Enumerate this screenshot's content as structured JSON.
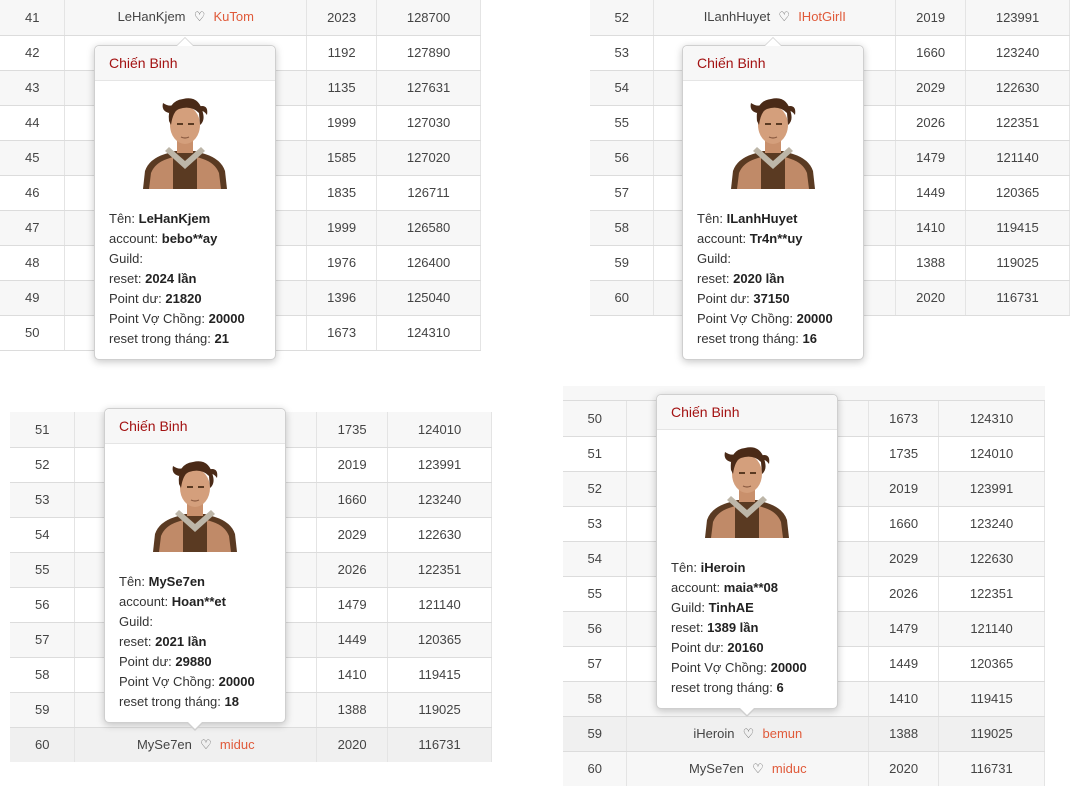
{
  "heart_glyph": "♡",
  "panels": [
    {
      "rows": [
        {
          "rank": "41",
          "name": "LeHanKjem",
          "partner": "KuTom",
          "reset": "2023",
          "point": "128700"
        },
        {
          "rank": "42",
          "name": "",
          "partner": "",
          "reset": "1192",
          "point": "127890"
        },
        {
          "rank": "43",
          "name": "",
          "partner": "",
          "reset": "1135",
          "point": "127631"
        },
        {
          "rank": "44",
          "name": "",
          "partner": "",
          "reset": "1999",
          "point": "127030"
        },
        {
          "rank": "45",
          "name": "",
          "partner": "",
          "reset": "1585",
          "point": "127020"
        },
        {
          "rank": "46",
          "name": "",
          "partner": "",
          "reset": "1835",
          "point": "126711"
        },
        {
          "rank": "47",
          "name": "",
          "partner": "",
          "reset": "1999",
          "point": "126580"
        },
        {
          "rank": "48",
          "name": "",
          "partner": "",
          "reset": "1976",
          "point": "126400"
        },
        {
          "rank": "49",
          "name": "",
          "partner": "",
          "reset": "1396",
          "point": "125040"
        },
        {
          "rank": "50",
          "name": "",
          "partner": "",
          "reset": "1673",
          "point": "124310"
        }
      ],
      "popup": {
        "title": "Chiến Binh",
        "lines": [
          {
            "label": "Tên: ",
            "value": "LeHanKjem"
          },
          {
            "label": "account: ",
            "value": "bebo**ay"
          },
          {
            "label": "Guild: ",
            "value": ""
          },
          {
            "label": "reset: ",
            "value": "2024 lần"
          },
          {
            "label": "Point dư: ",
            "value": "21820"
          },
          {
            "label": "Point Vợ Chồng: ",
            "value": "20000"
          },
          {
            "label": "reset trong tháng: ",
            "value": "21"
          }
        ]
      }
    },
    {
      "rows": [
        {
          "rank": "52",
          "name": "ILanhHuyet",
          "partner": "IHotGirlI",
          "reset": "2019",
          "point": "123991"
        },
        {
          "rank": "53",
          "name": "",
          "partner": "",
          "reset": "1660",
          "point": "123240"
        },
        {
          "rank": "54",
          "name": "",
          "partner": "",
          "reset": "2029",
          "point": "122630"
        },
        {
          "rank": "55",
          "name": "",
          "partner": "",
          "reset": "2026",
          "point": "122351"
        },
        {
          "rank": "56",
          "name": "",
          "partner": "",
          "reset": "1479",
          "point": "121140"
        },
        {
          "rank": "57",
          "name": "",
          "partner": "",
          "reset": "1449",
          "point": "120365"
        },
        {
          "rank": "58",
          "name": "",
          "partner": "",
          "reset": "1410",
          "point": "119415"
        },
        {
          "rank": "59",
          "name": "",
          "partner": "",
          "reset": "1388",
          "point": "119025"
        },
        {
          "rank": "60",
          "name": "",
          "partner": "",
          "reset": "2020",
          "point": "116731"
        }
      ],
      "popup": {
        "title": "Chiến Binh",
        "lines": [
          {
            "label": "Tên: ",
            "value": "ILanhHuyet"
          },
          {
            "label": "account: ",
            "value": "Tr4n**uy"
          },
          {
            "label": "Guild: ",
            "value": ""
          },
          {
            "label": "reset: ",
            "value": "2020 lần"
          },
          {
            "label": "Point dư: ",
            "value": "37150"
          },
          {
            "label": "Point Vợ Chồng: ",
            "value": "20000"
          },
          {
            "label": "reset trong tháng: ",
            "value": "16"
          }
        ]
      }
    },
    {
      "rows": [
        {
          "rank": "51",
          "name": "",
          "partner": "",
          "reset": "1735",
          "point": "124010"
        },
        {
          "rank": "52",
          "name": "",
          "partner": "",
          "reset": "2019",
          "point": "123991"
        },
        {
          "rank": "53",
          "name": "",
          "partner": "",
          "reset": "1660",
          "point": "123240"
        },
        {
          "rank": "54",
          "name": "",
          "partner": "",
          "reset": "2029",
          "point": "122630"
        },
        {
          "rank": "55",
          "name": "",
          "partner": "",
          "reset": "2026",
          "point": "122351"
        },
        {
          "rank": "56",
          "name": "",
          "partner": "",
          "reset": "1479",
          "point": "121140"
        },
        {
          "rank": "57",
          "name": "",
          "partner": "",
          "reset": "1449",
          "point": "120365"
        },
        {
          "rank": "58",
          "name": "",
          "partner": "",
          "reset": "1410",
          "point": "119415"
        },
        {
          "rank": "59",
          "name": "",
          "partner": "",
          "reset": "1388",
          "point": "119025"
        },
        {
          "rank": "60",
          "name": "MySe7en",
          "partner": "miduc",
          "reset": "2020",
          "point": "116731"
        }
      ],
      "popup": {
        "title": "Chiến Binh",
        "lines": [
          {
            "label": "Tên: ",
            "value": "MySe7en"
          },
          {
            "label": "account: ",
            "value": "Hoan**et"
          },
          {
            "label": "Guild: ",
            "value": ""
          },
          {
            "label": "reset: ",
            "value": "2021 lần"
          },
          {
            "label": "Point dư: ",
            "value": "29880"
          },
          {
            "label": "Point Vợ Chồng: ",
            "value": "20000"
          },
          {
            "label": "reset trong tháng: ",
            "value": "18"
          }
        ]
      }
    },
    {
      "rows": [
        {
          "rank": "50",
          "name": "",
          "partner": "",
          "reset": "1673",
          "point": "124310"
        },
        {
          "rank": "51",
          "name": "",
          "partner": "",
          "reset": "1735",
          "point": "124010"
        },
        {
          "rank": "52",
          "name": "",
          "partner": "",
          "reset": "2019",
          "point": "123991"
        },
        {
          "rank": "53",
          "name": "",
          "partner": "",
          "reset": "1660",
          "point": "123240"
        },
        {
          "rank": "54",
          "name": "",
          "partner": "",
          "reset": "2029",
          "point": "122630"
        },
        {
          "rank": "55",
          "name": "",
          "partner": "",
          "reset": "2026",
          "point": "122351"
        },
        {
          "rank": "56",
          "name": "",
          "partner": "",
          "reset": "1479",
          "point": "121140"
        },
        {
          "rank": "57",
          "name": "",
          "partner": "",
          "reset": "1449",
          "point": "120365"
        },
        {
          "rank": "58",
          "name": "",
          "partner": "",
          "reset": "1410",
          "point": "119415"
        },
        {
          "rank": "59",
          "name": "iHeroin",
          "partner": "bemun",
          "reset": "1388",
          "point": "119025"
        },
        {
          "rank": "60",
          "name": "MySe7en",
          "partner": "miduc",
          "reset": "2020",
          "point": "116731"
        }
      ],
      "popup": {
        "title": "Chiến Binh",
        "lines": [
          {
            "label": "Tên: ",
            "value": "iHeroin"
          },
          {
            "label": "account: ",
            "value": "maia**08"
          },
          {
            "label": "Guild: ",
            "value": "TinhAE"
          },
          {
            "label": "reset: ",
            "value": "1389 lần"
          },
          {
            "label": "Point dư: ",
            "value": "20160"
          },
          {
            "label": "Point Vợ Chồng: ",
            "value": "20000"
          },
          {
            "label": "reset trong tháng: ",
            "value": "6"
          }
        ]
      }
    }
  ]
}
